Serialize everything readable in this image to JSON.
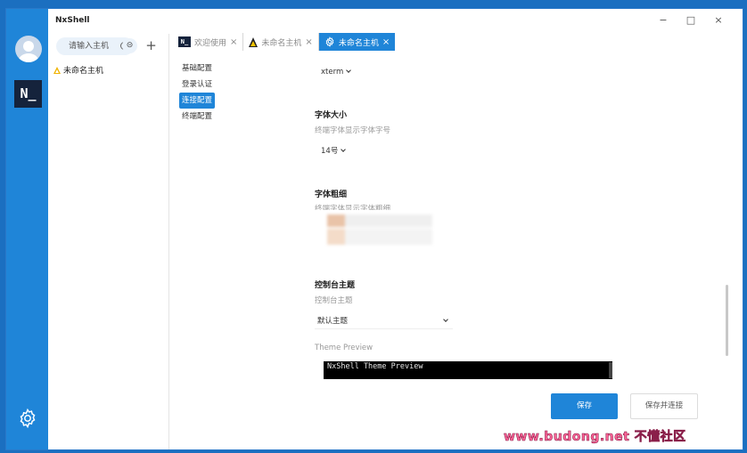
{
  "app": {
    "title": "NxShell",
    "logo_text": "N_",
    "window_controls": {
      "minimize": "−",
      "maximize": "□",
      "close": "×"
    }
  },
  "host_panel": {
    "search_placeholder": "请输入主机",
    "folder_symbol": "⊝",
    "add_symbol": "+",
    "hosts": [
      {
        "name": "未命名主机",
        "icon": "linux-icon"
      }
    ]
  },
  "tabs": [
    {
      "label": "欢迎使用",
      "close": "×",
      "icon": "nxshell-icon",
      "active": false
    },
    {
      "label": "未命名主机",
      "close": "×",
      "icon": "linux-icon",
      "active": false
    },
    {
      "label": "未命名主机",
      "close": "×",
      "icon": "gear-icon",
      "active": true
    }
  ],
  "config_nav": [
    {
      "label": "基础配置",
      "active": false
    },
    {
      "label": "登录认证",
      "active": false
    },
    {
      "label": "连接配置",
      "active": true
    },
    {
      "label": "终端配置",
      "active": false
    }
  ],
  "content": {
    "terminal_type_value": "xterm",
    "font_size": {
      "title": "字体大小",
      "desc": "终端字体显示字体字号",
      "value": "14号"
    },
    "font_weight": {
      "title": "字体粗细",
      "desc": "终端字体显示字体粗细"
    },
    "console_theme": {
      "title": "控制台主题",
      "desc": "控制台主题",
      "value": "默认主题",
      "preview_label": "Theme Preview",
      "preview_text": "NxShell Theme Preview"
    }
  },
  "buttons": {
    "save": "保存",
    "save_connect": "保存并连接"
  },
  "watermark": "www.budong.net 不懂社区",
  "colors": {
    "accent": "#1f85d8",
    "rail": "#1f85d8",
    "preview_bg": "#000000"
  }
}
